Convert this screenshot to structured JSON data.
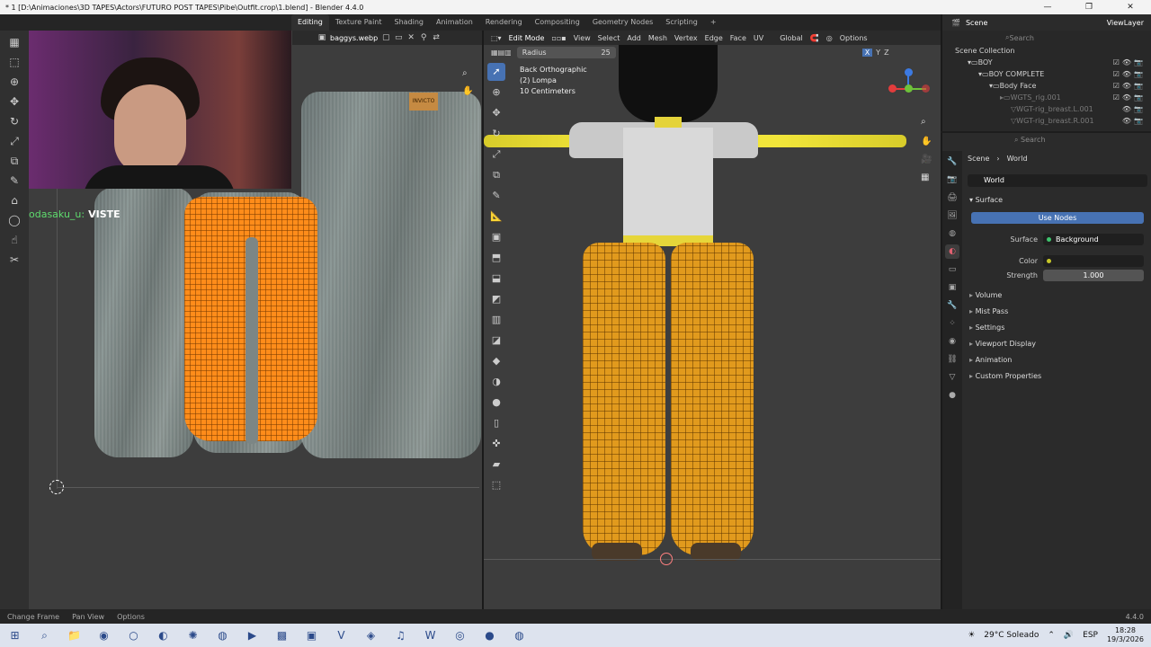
{
  "window": {
    "title": "* 1 [D:\\Animaciones\\3D TAPES\\Actors\\FUTURO POST TAPES\\Pibe\\Outfit.crop\\1.blend] - Blender 4.4.0",
    "minimize": "—",
    "maximize": "❐",
    "close": "✕"
  },
  "workspaces": [
    "Editing",
    "Texture Paint",
    "Shading",
    "Animation",
    "Rendering",
    "Compositing",
    "Geometry Nodes",
    "Scripting"
  ],
  "workspace_active": "Editing",
  "workspace_add": "+",
  "uv_editor": {
    "image_name": "baggys.webp",
    "label_on_texture": "INVICTO",
    "chat_user": "odasaku_u:",
    "chat_message": "VISTE"
  },
  "viewport": {
    "mode": "Edit Mode",
    "menus": [
      "View",
      "Select",
      "Add",
      "Mesh",
      "Vertex",
      "Edge",
      "Face",
      "UV"
    ],
    "orientation": "Global",
    "options_label": "Options",
    "radius_label": "Radius",
    "radius_value": "25",
    "info_view": "Back Orthographic",
    "info_object": "(2) Lompa",
    "info_scale": "10 Centimeters",
    "axes": [
      "X",
      "Y",
      "Z"
    ]
  },
  "outliner": {
    "scene": "Scene",
    "view_layer": "ViewLayer",
    "search_placeholder": "Search",
    "rows": [
      {
        "label": "Scene Collection",
        "dim": false
      },
      {
        "label": "BOY",
        "dim": false
      },
      {
        "label": "BOY COMPLETE",
        "dim": false
      },
      {
        "label": "Body Face",
        "dim": false
      },
      {
        "label": "WGTS_rig.001",
        "dim": true
      },
      {
        "label": "WGT-rig_breast.L.001",
        "dim": true
      },
      {
        "label": "WGT-rig_breast.R.001",
        "dim": true
      }
    ]
  },
  "properties": {
    "search_placeholder": "Search",
    "breadcrumb_scene": "Scene",
    "breadcrumb_world": "World",
    "world_name": "World",
    "surface_title": "Surface",
    "use_nodes": "Use Nodes",
    "surface_label": "Surface",
    "surface_value": "Background",
    "color_label": "Color",
    "strength_label": "Strength",
    "strength_value": "1.000",
    "collapsed_panels": [
      "Volume",
      "Mist Pass",
      "Settings",
      "Viewport Display",
      "Animation",
      "Custom Properties"
    ]
  },
  "statusbar": {
    "items": [
      "Change Frame",
      "Pan View",
      "Options"
    ],
    "version": "4.4.0"
  },
  "taskbar": {
    "weather": "29°C Soleado",
    "lang": "ESP",
    "time": "18:28",
    "date": "19/3/2026"
  },
  "colors": {
    "accent_blue": "#4772b3",
    "mesh_orange": "#ff8c1a",
    "armature_yellow": "#f1e53a"
  }
}
